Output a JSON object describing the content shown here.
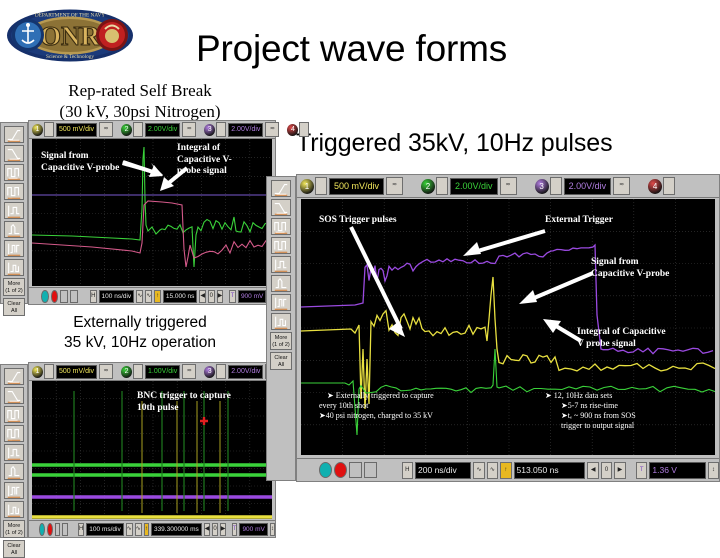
{
  "slide": {
    "title": "Project wave forms",
    "subtitle": "Triggered 35kV, 10Hz pulses",
    "caption_top_left_line1": "Rep-rated Self Break",
    "caption_top_left_line2": "(30 kV, 30psi Nitrogen)",
    "caption_mid_left_line1": "Externally triggered",
    "caption_mid_left_line2": "35 kV, 10Hz operation"
  },
  "logo": {
    "name": "onr-seal",
    "ring_top_text": "DEPARTMENT OF THE NAVY",
    "ring_bottom_text": "Science & Technology",
    "center_text": "ONR",
    "left_badge": "USN anchor",
    "right_badge": "USMC eagle globe anchor",
    "colors": {
      "ring": "#1b3a7a",
      "center": "#c8a24a",
      "left": "#2f6fb5",
      "right": "#c02020"
    }
  },
  "scope_top_left": {
    "name": "self-break-capture",
    "channels": [
      {
        "id": "1",
        "color": "#f2e85c",
        "value": "500 mV/div"
      },
      {
        "id": "2",
        "color": "#3ad23a",
        "value": "2.00V/div"
      },
      {
        "id": "3",
        "color": "#b07de0",
        "value": "2.00V/div"
      },
      {
        "id": "4",
        "color": "#e04a4a",
        "value": ""
      }
    ],
    "bottom": {
      "timebase": "100 ns/div",
      "delay": "15.000 ns",
      "trigger_level": "900 mV"
    },
    "annotations": [
      "Signal from Capacitive V-probe",
      "Integral of Capacitive V-probe signal"
    ]
  },
  "scope_bottom_left": {
    "name": "external-trigger-10hz-capture",
    "channels": [
      {
        "id": "1",
        "color": "#f2e85c",
        "value": "500 mV/div"
      },
      {
        "id": "2",
        "color": "#3ad23a",
        "value": "1.00V/div"
      },
      {
        "id": "3",
        "color": "#b07de0",
        "value": "2.00V/div"
      },
      {
        "id": "4",
        "color": "#e04a4a",
        "value": ""
      }
    ],
    "bottom": {
      "timebase": "100 ms/div",
      "delay": "339.300000 ms",
      "trigger_level": "900 mV"
    },
    "annotations": [
      "BNC trigger to capture",
      "10th pulse"
    ]
  },
  "scope_right": {
    "name": "triggered-35kv-10hz-capture",
    "channels": [
      {
        "id": "1",
        "color": "#f2e85c",
        "value": "500 mV/div"
      },
      {
        "id": "2",
        "color": "#3ad23a",
        "value": "2.00V/div"
      },
      {
        "id": "3",
        "color": "#b07de0",
        "value": "2.00V/div"
      },
      {
        "id": "4",
        "color": "#e04a4a",
        "value": ""
      }
    ],
    "bottom": {
      "timebase": "200 ns/div",
      "delay": "513.050 ns",
      "trigger_level": "1.36 V"
    },
    "annotations": {
      "sos": "SOS Trigger pulses",
      "external_trigger": "External Trigger",
      "signal_probe_l1": "Signal from",
      "signal_probe_l2": "Capacitive V-probe",
      "integral_l1": "Integral of Capacitive",
      "integral_l2": "V probe signal"
    },
    "bullets_left": [
      "➤ Externally triggered to capture",
      "every 10th shot",
      "➤40 psi nitrogen, charged to 35 kV"
    ],
    "bullets_right": [
      "➤ 12, 10Hz data sets",
      "➤5-7 ns rise-time",
      "➤tₑ ~ 900 ns from SOS",
      "trigger to output signal"
    ]
  },
  "toolbar": {
    "name": "measurement-toolbar",
    "buttons": [
      "rise-time-icon",
      "fall-time-icon",
      "period-icon",
      "width-icon",
      "amplitude-icon",
      "overshoot-icon",
      "delay-icon",
      "phase-icon"
    ],
    "more_label_l1": "More",
    "more_label_l2": "(1 of 2)",
    "clear_label_l1": "Clear",
    "clear_label_l2": "All"
  }
}
